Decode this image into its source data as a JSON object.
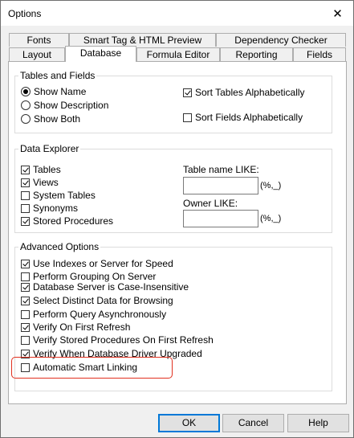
{
  "window": {
    "title": "Options",
    "close_glyph": "✕"
  },
  "tabs_back": [
    {
      "label": "Fonts"
    },
    {
      "label": "Smart Tag & HTML Preview"
    },
    {
      "label": "Dependency Checker"
    }
  ],
  "tabs_front": [
    {
      "label": "Layout"
    },
    {
      "label": "Database",
      "active": true
    },
    {
      "label": "Formula Editor"
    },
    {
      "label": "Reporting"
    },
    {
      "label": "Fields"
    }
  ],
  "tables_fields": {
    "title": "Tables and Fields",
    "radios": [
      {
        "label": "Show Name",
        "checked": true
      },
      {
        "label": "Show Description",
        "checked": false
      },
      {
        "label": "Show Both",
        "checked": false
      }
    ],
    "sort_tables": {
      "label": "Sort Tables Alphabetically",
      "checked": true
    },
    "sort_fields": {
      "label": "Sort Fields Alphabetically",
      "checked": false
    }
  },
  "data_explorer": {
    "title": "Data Explorer",
    "items": [
      {
        "label": "Tables",
        "checked": true
      },
      {
        "label": "Views",
        "checked": true
      },
      {
        "label": "System Tables",
        "checked": false
      },
      {
        "label": "Synonyms",
        "checked": false
      },
      {
        "label": "Stored Procedures",
        "checked": true
      }
    ],
    "table_name_label": "Table name LIKE:",
    "table_name_value": "",
    "table_name_hint": "(%,_)",
    "owner_label": "Owner LIKE:",
    "owner_value": "",
    "owner_hint": "(%,_)"
  },
  "advanced": {
    "title": "Advanced Options",
    "items": [
      {
        "label": "Use Indexes or Server for Speed",
        "checked": true
      },
      {
        "label": "Perform Grouping On Server",
        "checked": false
      },
      {
        "label": "Database Server is Case-Insensitive",
        "checked": true
      },
      {
        "label": "Select Distinct Data for Browsing",
        "checked": true
      },
      {
        "label": "Perform Query Asynchronously",
        "checked": false
      },
      {
        "label": "Verify On First Refresh",
        "checked": true
      },
      {
        "label": "Verify Stored Procedures On First Refresh",
        "checked": false
      },
      {
        "label": "Verify When Database Driver Upgraded",
        "checked": true
      },
      {
        "label": "Automatic Smart Linking",
        "checked": false
      }
    ]
  },
  "buttons": {
    "ok": "OK",
    "cancel": "Cancel",
    "help": "Help"
  },
  "colors": {
    "highlight": "#e1301f",
    "default_button_border": "#0078d7"
  }
}
